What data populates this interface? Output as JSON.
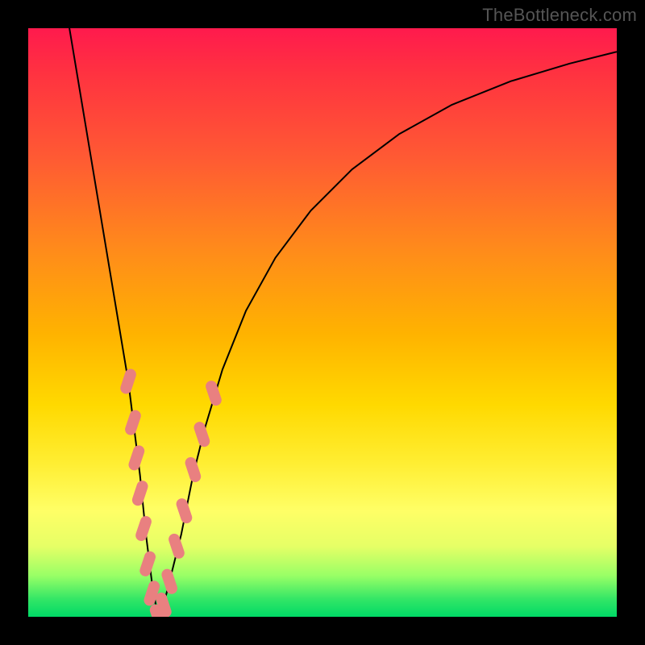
{
  "watermark": "TheBottleneck.com",
  "chart_data": {
    "type": "line",
    "title": "",
    "xlabel": "",
    "ylabel": "",
    "xlim": [
      0,
      100
    ],
    "ylim": [
      0,
      100
    ],
    "gradient_stops": [
      {
        "pos": 0,
        "color": "#ff1a4d"
      },
      {
        "pos": 8,
        "color": "#ff3340"
      },
      {
        "pos": 22,
        "color": "#ff5a33"
      },
      {
        "pos": 38,
        "color": "#ff8c1a"
      },
      {
        "pos": 52,
        "color": "#ffb300"
      },
      {
        "pos": 64,
        "color": "#ffd900"
      },
      {
        "pos": 74,
        "color": "#ffee33"
      },
      {
        "pos": 82,
        "color": "#ffff66"
      },
      {
        "pos": 88,
        "color": "#e6ff66"
      },
      {
        "pos": 93,
        "color": "#99ff66"
      },
      {
        "pos": 97,
        "color": "#33e666"
      },
      {
        "pos": 100,
        "color": "#00d966"
      }
    ],
    "series": [
      {
        "name": "bottleneck-curve",
        "x": [
          7,
          9,
          11,
          13,
          15,
          17,
          18,
          19,
          20,
          21,
          22,
          23,
          24,
          26,
          28,
          30,
          33,
          37,
          42,
          48,
          55,
          63,
          72,
          82,
          92,
          100
        ],
        "y": [
          100,
          88,
          76,
          64,
          52,
          40,
          32,
          24,
          14,
          6,
          0,
          2,
          6,
          14,
          24,
          32,
          42,
          52,
          61,
          69,
          76,
          82,
          87,
          91,
          94,
          96
        ]
      }
    ],
    "markers": {
      "name": "highlighted-points",
      "color": "#e98080",
      "points": [
        {
          "x": 17.0,
          "y": 40
        },
        {
          "x": 17.8,
          "y": 33
        },
        {
          "x": 18.4,
          "y": 27
        },
        {
          "x": 19.0,
          "y": 21
        },
        {
          "x": 19.6,
          "y": 15
        },
        {
          "x": 20.3,
          "y": 9
        },
        {
          "x": 21.0,
          "y": 4
        },
        {
          "x": 22.0,
          "y": 0
        },
        {
          "x": 23.0,
          "y": 2
        },
        {
          "x": 24.0,
          "y": 6
        },
        {
          "x": 25.2,
          "y": 12
        },
        {
          "x": 26.5,
          "y": 18
        },
        {
          "x": 28.0,
          "y": 25
        },
        {
          "x": 29.5,
          "y": 31
        },
        {
          "x": 31.5,
          "y": 38
        }
      ]
    }
  }
}
